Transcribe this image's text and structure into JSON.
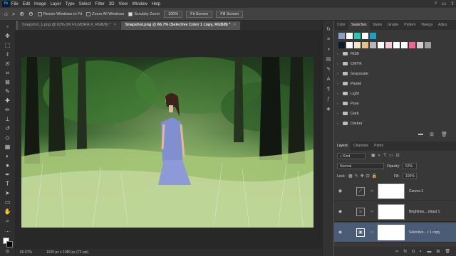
{
  "app": {
    "logo": "Ps"
  },
  "menu": [
    "File",
    "Edit",
    "Image",
    "Layer",
    "Type",
    "Select",
    "Filter",
    "3D",
    "View",
    "Window",
    "Help"
  ],
  "window_controls": [
    "search-icon",
    "workspace-icon",
    "share-icon"
  ],
  "options": {
    "resize_windows": "Resize Windows to Fit",
    "zoom_all": "Zoom All Windows",
    "scrubby_zoom": "Scrubby Zoom",
    "zoom_value": "100%",
    "fit_screen": "Fit Screen",
    "fill_screen": "Fill Screen"
  },
  "tabs": [
    {
      "label": "Snapshot_1.png @ 63% (IN FILMORA X, RGB/8) *",
      "close": "×"
    },
    {
      "label": "Snapshot.png @ 66.7% (Selective Color 1 copy, RGB/8) *",
      "close": "×"
    }
  ],
  "status": {
    "zoom": "66.67%",
    "doc": "1920 px x 1080 px (72 ppi)"
  },
  "swatches_panel": {
    "tabs": [
      "Color",
      "Swatches",
      "Styles",
      "Gradie",
      "Pattern",
      "Naviga",
      "Adjus"
    ],
    "recent": [
      "#ffffff",
      "#3a7bd5",
      "#2ec4b6",
      "#ffffff",
      "#20a0c0"
    ],
    "swatch_row": [
      "#0d1b2a",
      "#ffffff",
      "#f2e6c9",
      "#e6c08a",
      "#b8b8b8",
      "#ffffff",
      "#f7c6d9",
      "#ffffff",
      "#ffffff",
      "#f06595",
      "#d0d0d0",
      "#9e9e9e"
    ],
    "folders": [
      "RGB",
      "CMYK",
      "Grayscale",
      "Pastel",
      "Light",
      "Pure",
      "Dark",
      "Darker"
    ]
  },
  "layers_panel": {
    "tabs": [
      "Layers",
      "Channels",
      "Paths"
    ],
    "filter": "Kind",
    "blend": "Normal",
    "opacity_label": "Opacity:",
    "opacity": "52%",
    "lock_label": "Lock:",
    "fill_label": "Fill:",
    "fill": "100%",
    "layers": [
      {
        "name": "Curves 1",
        "icon": "curves-icon",
        "glyph": "⟋",
        "selected": false
      },
      {
        "name": "Brightnes....ntrast 1",
        "icon": "brightness-icon",
        "glyph": "☼",
        "selected": false
      },
      {
        "name": "Selective....r 1 copy",
        "icon": "selective-color-icon",
        "glyph": "▣",
        "selected": true
      }
    ],
    "footer": [
      "fx"
    ]
  }
}
